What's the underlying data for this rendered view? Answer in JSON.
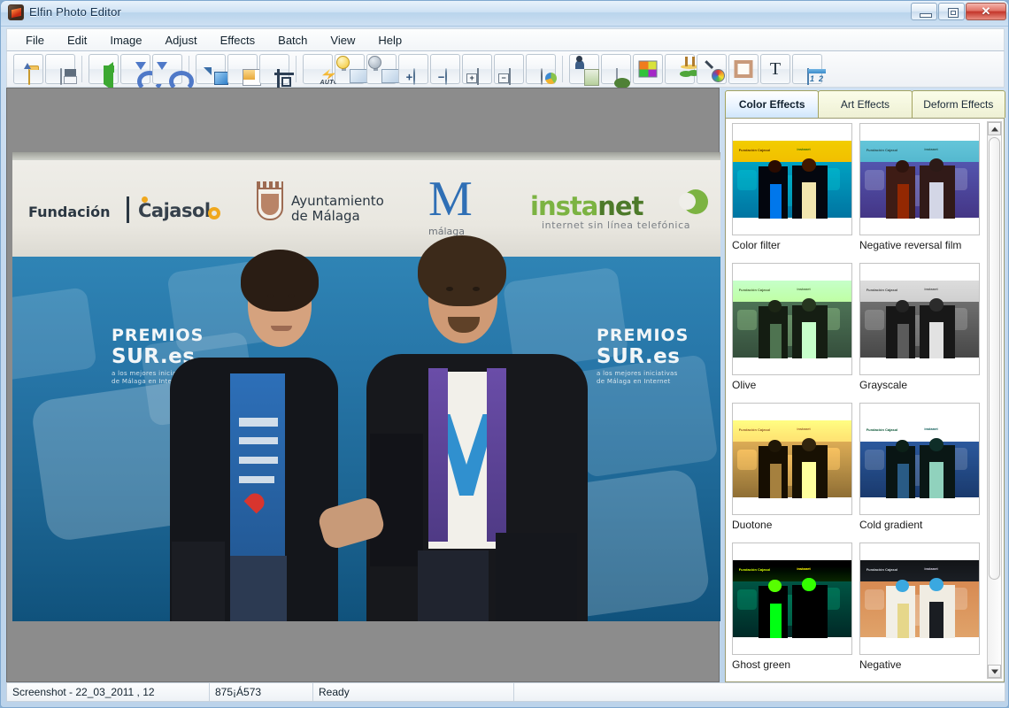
{
  "window": {
    "title": "Elfin Photo Editor",
    "app_icon": "app-logo-icon",
    "controls": {
      "minimize": "minimize-icon",
      "maximize": "maximize-icon",
      "close": "✕"
    }
  },
  "menu": {
    "items": [
      {
        "label": "File"
      },
      {
        "label": "Edit"
      },
      {
        "label": "Image"
      },
      {
        "label": "Adjust"
      },
      {
        "label": "Effects"
      },
      {
        "label": "Batch"
      },
      {
        "label": "View"
      },
      {
        "label": "Help"
      }
    ]
  },
  "toolbar": {
    "buttons": [
      {
        "icon": "open-folder-icon",
        "name": "open-button"
      },
      {
        "icon": "save-disk-icon",
        "name": "save-button"
      },
      {
        "sep": true
      },
      {
        "icon": "green-left-arrow-icon",
        "name": "back-button"
      },
      {
        "icon": "undo-arrow-icon",
        "name": "undo-button"
      },
      {
        "icon": "redo-arrow-icon",
        "name": "redo-button"
      },
      {
        "sep": true
      },
      {
        "icon": "resize-image-icon",
        "name": "resize-button"
      },
      {
        "icon": "canvas-size-icon",
        "name": "canvas-size-button"
      },
      {
        "icon": "crop-icon",
        "name": "crop-button"
      },
      {
        "sep": true
      },
      {
        "icon": "auto-enhance-icon",
        "name": "auto-enhance-button",
        "label": "AUTO"
      },
      {
        "icon": "brightness-up-icon",
        "name": "brightness-up-button"
      },
      {
        "icon": "brightness-down-icon",
        "name": "brightness-down-button"
      },
      {
        "icon": "contrast-plus-icon",
        "name": "contrast-increase-button"
      },
      {
        "icon": "contrast-minus-icon",
        "name": "contrast-decrease-button"
      },
      {
        "icon": "saturation-plus-icon",
        "name": "saturation-increase-button"
      },
      {
        "icon": "saturation-minus-icon",
        "name": "saturation-decrease-button"
      },
      {
        "icon": "color-balance-icon",
        "name": "color-balance-button"
      },
      {
        "sep": true
      },
      {
        "icon": "portrait-icon",
        "name": "portrait-effect-button"
      },
      {
        "icon": "landscape-icon",
        "name": "landscape-effect-button"
      },
      {
        "icon": "color-quad-icon",
        "name": "color-effects-button"
      },
      {
        "icon": "palm-tree-icon",
        "name": "scene-effects-button"
      },
      {
        "icon": "color-wheel-magnifier-icon",
        "name": "color-picker-button"
      },
      {
        "icon": "picture-frame-icon",
        "name": "frame-button"
      },
      {
        "icon": "text-t-icon",
        "name": "text-button"
      },
      {
        "icon": "two-pane-icon",
        "name": "compare-view-button"
      }
    ]
  },
  "tabs": [
    {
      "label": "Color Effects",
      "active": true
    },
    {
      "label": "Art Effects",
      "active": false
    },
    {
      "label": "Deform Effects",
      "active": false
    }
  ],
  "effects": [
    {
      "label": "Color filter"
    },
    {
      "label": "Negative reversal film"
    },
    {
      "label": "Olive"
    },
    {
      "label": "Grayscale"
    },
    {
      "label": "Duotone"
    },
    {
      "label": "Cold gradient"
    },
    {
      "label": "Ghost green"
    },
    {
      "label": "Negative"
    }
  ],
  "scrollbar": {
    "up": "scroll-up-arrow",
    "down": "scroll-down-arrow"
  },
  "photo": {
    "logos": {
      "fundacion": "Fundación",
      "cajasol": "Cajasol",
      "ayuntamiento_line1": "Ayuntamiento",
      "ayuntamiento_line2": "de Málaga",
      "m_mark": "M",
      "malaga": "málaga",
      "instanet_part1": "insta",
      "instanet_part2": "net",
      "instanet_tagline": "internet sin línea telefónica"
    },
    "backdrop": {
      "premios": "PREMIOS",
      "sures": "SUR.es",
      "small_line1": "a los mejores iniciativas",
      "small_line2": "de Málaga en Internet"
    }
  },
  "statusbar": {
    "filename": "Screenshot - 22_03_2011 , 12",
    "dimensions": "875¡Á573",
    "state": "Ready",
    "extra": ""
  }
}
